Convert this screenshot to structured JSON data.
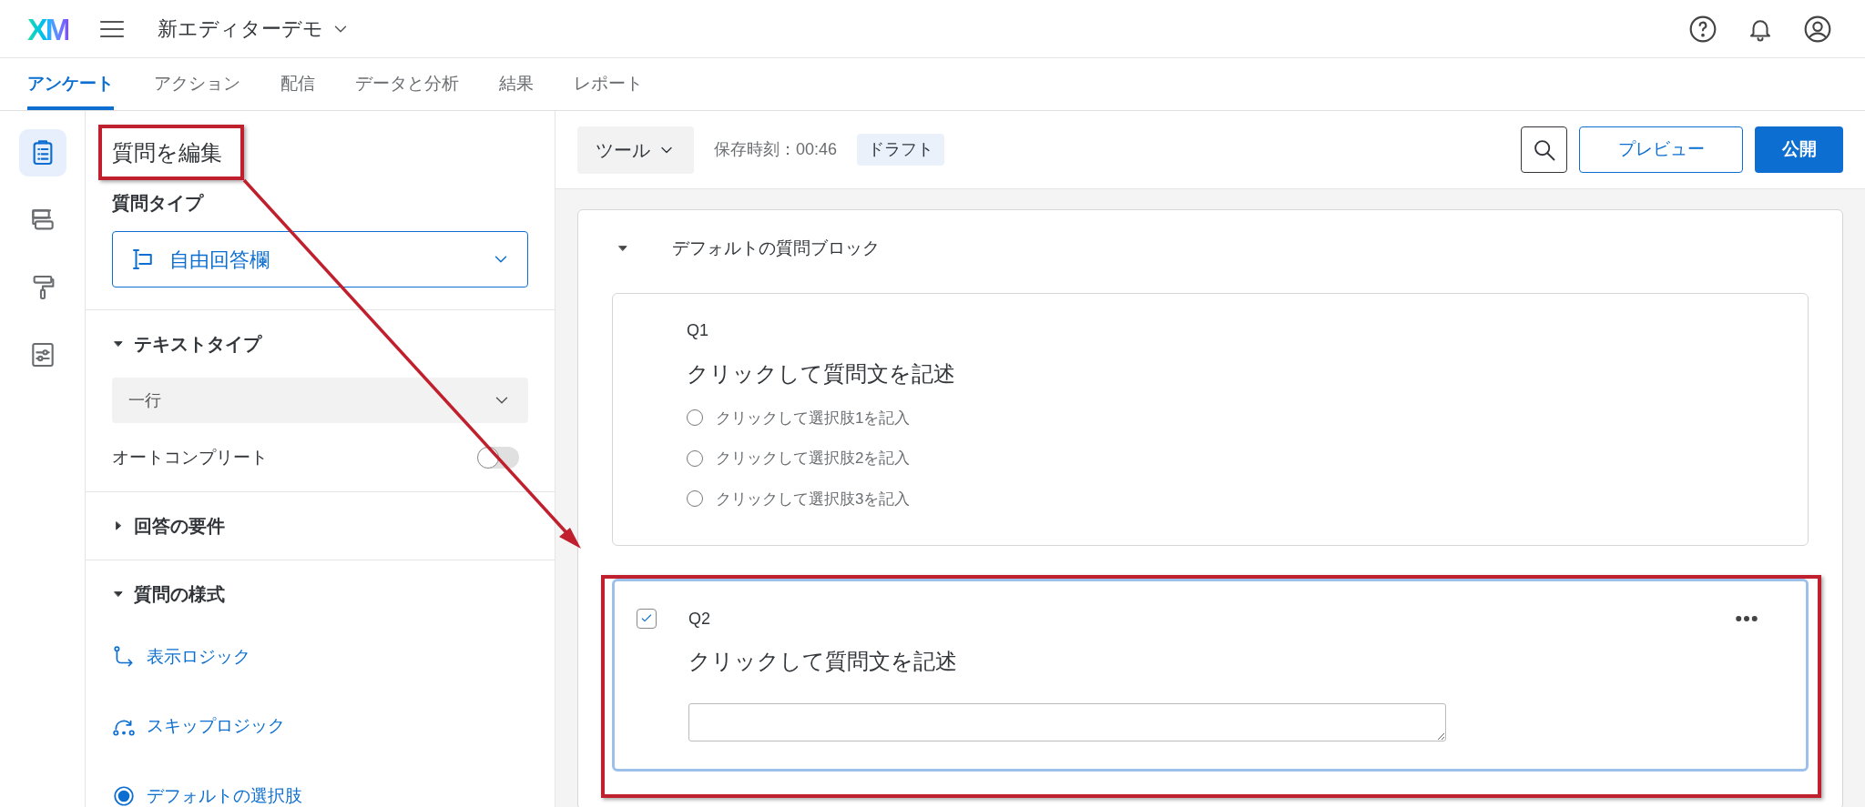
{
  "header": {
    "logo": "XM",
    "project_title": "新エディターデモ"
  },
  "tabs": [
    {
      "label": "アンケート",
      "selected": true
    },
    {
      "label": "アクション",
      "selected": false
    },
    {
      "label": "配信",
      "selected": false
    },
    {
      "label": "データと分析",
      "selected": false
    },
    {
      "label": "結果",
      "selected": false
    },
    {
      "label": "レポート",
      "selected": false
    }
  ],
  "tool_rail": [
    {
      "kind": "survey",
      "selected": true
    },
    {
      "kind": "blocks",
      "selected": false
    },
    {
      "kind": "look",
      "selected": false
    },
    {
      "kind": "options",
      "selected": false
    }
  ],
  "edit_panel": {
    "title": "質問を編集",
    "question_type": {
      "label": "質問タイプ",
      "value": "自由回答欄"
    },
    "sections": [
      {
        "title": "テキストタイプ",
        "expanded": true,
        "select_value": "一行",
        "autocomplete": {
          "label": "オートコンプリート",
          "on": false
        }
      },
      {
        "title": "回答の要件",
        "expanded": false
      },
      {
        "title": "質問の様式",
        "expanded": true,
        "links": [
          {
            "kind": "display_logic",
            "label": "表示ロジック"
          },
          {
            "kind": "skip_logic",
            "label": "スキップロジック"
          },
          {
            "kind": "default_choice",
            "label": "デフォルトの選択肢"
          }
        ]
      }
    ]
  },
  "toolbar": {
    "tools": "ツール",
    "saved": "保存時刻：00:46",
    "status": "ドラフト",
    "preview": "プレビュー",
    "publish": "公開"
  },
  "block": {
    "title": "デフォルトの質問ブロック",
    "expanded": true,
    "questions": [
      {
        "number": "Q1",
        "kind": "multiple_choice",
        "selected": false,
        "text": "クリックして質問文を記述",
        "choices": [
          {
            "label": "クリックして選択肢1を記入",
            "selected": false
          },
          {
            "label": "クリックして選択肢2を記入",
            "selected": false
          },
          {
            "label": "クリックして選択肢3を記入",
            "selected": false
          }
        ]
      },
      {
        "number": "Q2",
        "kind": "text_entry",
        "selected": true,
        "text": "クリックして質問文を記述"
      }
    ]
  }
}
